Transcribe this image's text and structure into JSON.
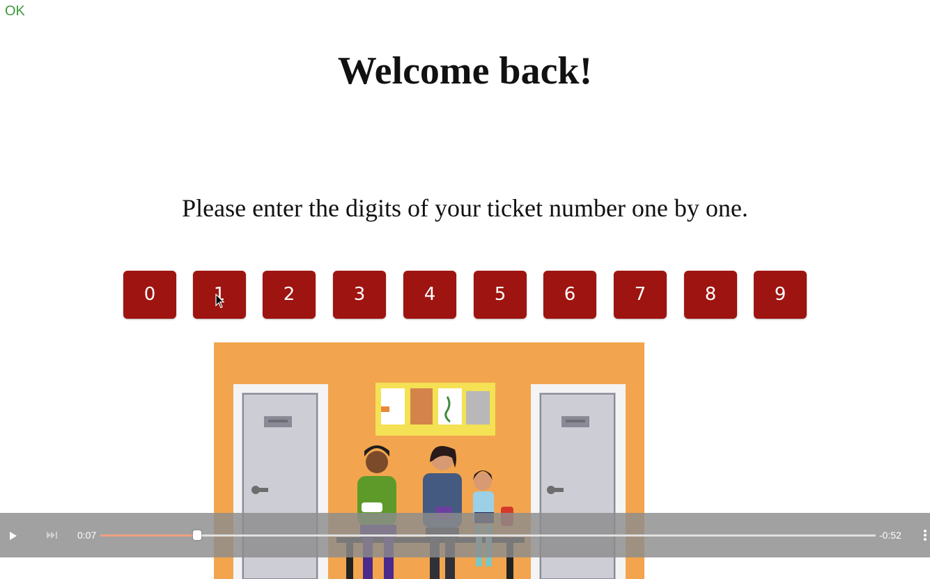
{
  "status": {
    "ok_label": "OK"
  },
  "header": {
    "title": "Welcome back!"
  },
  "instructions": "Please enter the digits of your ticket number one by one.",
  "keypad": {
    "digits": [
      "0",
      "1",
      "2",
      "3",
      "4",
      "5",
      "6",
      "7",
      "8",
      "9"
    ],
    "button_color": "#9e1410"
  },
  "video": {
    "scene": "waiting-room-illustration",
    "background_color": "#f2a54e",
    "elapsed": "0:07",
    "remaining": "-0:52",
    "progress": 0.125
  },
  "icons": {
    "play": "play-icon",
    "skip": "skip-forward-icon",
    "menu": "more-vertical-icon"
  }
}
